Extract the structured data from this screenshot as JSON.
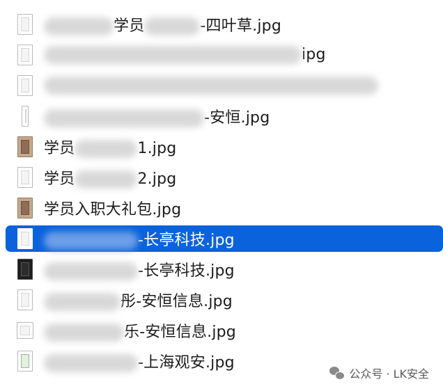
{
  "files": [
    {
      "prefix": "",
      "blur_before": 100,
      "mid": "学员",
      "blur_mid": 80,
      "suffix": "-四叶草.jpg",
      "thumb": "normal",
      "selected": false
    },
    {
      "prefix": "",
      "blur_before": 370,
      "mid": "",
      "blur_mid": 0,
      "suffix": "ipg",
      "thumb": "normal",
      "selected": false
    },
    {
      "prefix": "",
      "blur_before": 480,
      "mid": "",
      "blur_mid": 0,
      "suffix": "",
      "thumb": "normal",
      "selected": false
    },
    {
      "prefix": "",
      "blur_before": 230,
      "mid": "",
      "blur_mid": 0,
      "suffix": "-安恒.jpg",
      "thumb": "narrow",
      "selected": false
    },
    {
      "prefix": "学员",
      "blur_before": 0,
      "mid": "",
      "blur_mid": 90,
      "suffix": "1.jpg",
      "thumb": "photo",
      "selected": false
    },
    {
      "prefix": "学员",
      "blur_before": 0,
      "mid": "",
      "blur_mid": 90,
      "suffix": "2.jpg",
      "thumb": "normal",
      "selected": false
    },
    {
      "prefix": "学员入职大礼包.jpg",
      "blur_before": 0,
      "mid": "",
      "blur_mid": 0,
      "suffix": "",
      "thumb": "photo",
      "selected": false
    },
    {
      "prefix": "",
      "blur_before": 135,
      "mid": "",
      "blur_mid": 0,
      "suffix": "-长亭科技.jpg",
      "thumb": "sel",
      "selected": true
    },
    {
      "prefix": "",
      "blur_before": 135,
      "mid": "",
      "blur_mid": 0,
      "suffix": "-长亭科技.jpg",
      "thumb": "dark",
      "selected": false
    },
    {
      "prefix": "",
      "blur_before": 110,
      "mid": "彤",
      "blur_mid": 0,
      "suffix": "-安恒信息.jpg",
      "thumb": "normal",
      "selected": false
    },
    {
      "prefix": "",
      "blur_before": 115,
      "mid": "乐",
      "blur_mid": 0,
      "suffix": "-安恒信息.jpg",
      "thumb": "wide",
      "selected": false
    },
    {
      "prefix": "",
      "blur_before": 135,
      "mid": "",
      "blur_mid": 0,
      "suffix": "-上海观安.jpg",
      "thumb": "green",
      "selected": false
    }
  ],
  "footer": {
    "text": "公众号 · LK安全",
    "icon": "wechat-icon"
  }
}
